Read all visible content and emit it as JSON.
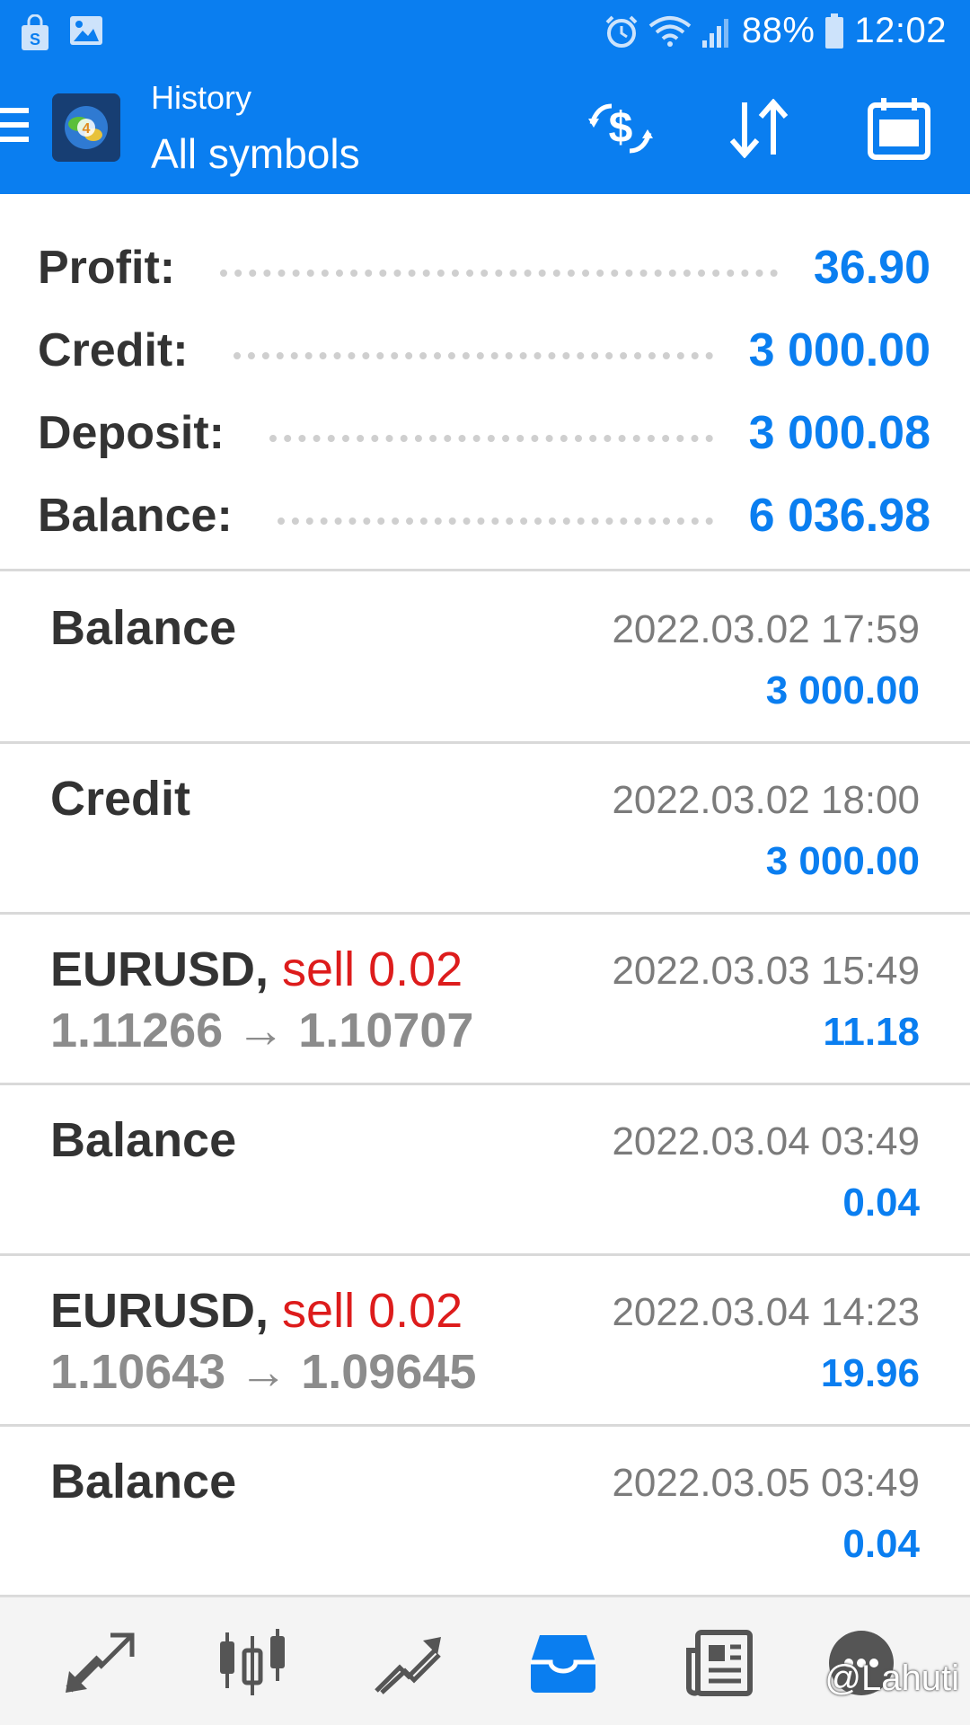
{
  "status_bar": {
    "battery": "88%",
    "time": "12:02",
    "icons": [
      "shopping-bag-icon",
      "gallery-icon",
      "alarm-icon",
      "wifi-icon",
      "signal-icon",
      "battery-icon"
    ]
  },
  "app_bar": {
    "subtitle": "History",
    "title": "All symbols",
    "actions": [
      "exchange-dollar-icon",
      "sort-icon",
      "calendar-icon"
    ]
  },
  "summary": [
    {
      "label": "Profit:",
      "value": "36.90"
    },
    {
      "label": "Credit:",
      "value": "3 000.00"
    },
    {
      "label": "Deposit:",
      "value": "3 000.08"
    },
    {
      "label": "Balance:",
      "value": "6 036.98"
    }
  ],
  "history": [
    {
      "title": "Balance",
      "date": "2022.03.02 17:59",
      "amount": "3 000.00"
    },
    {
      "title": "Credit",
      "date": "2022.03.02 18:00",
      "amount": "3 000.00"
    },
    {
      "symbol": "EURUSD,",
      "side": "sell 0.02",
      "price_open": "1.11266",
      "arrow": "→",
      "price_close": "1.10707",
      "date": "2022.03.03 15:49",
      "amount": "11.18"
    },
    {
      "title": "Balance",
      "date": "2022.03.04 03:49",
      "amount": "0.04"
    },
    {
      "symbol": "EURUSD,",
      "side": "sell 0.02",
      "price_open": "1.10643",
      "arrow": "→",
      "price_close": "1.09645",
      "date": "2022.03.04 14:23",
      "amount": "19.96"
    },
    {
      "title": "Balance",
      "date": "2022.03.05 03:49",
      "amount": "0.04"
    }
  ],
  "bottom_nav": {
    "items": [
      "quotes-icon",
      "chart-icon",
      "trade-icon",
      "history-icon",
      "news-icon",
      "chat-icon"
    ],
    "active": "history-icon",
    "watermark": "@Lahuti"
  },
  "colors": {
    "accent": "#0a7ef0",
    "sell": "#dd1c1c",
    "text_dark": "#333333",
    "text_grey": "#8c8c8c"
  }
}
